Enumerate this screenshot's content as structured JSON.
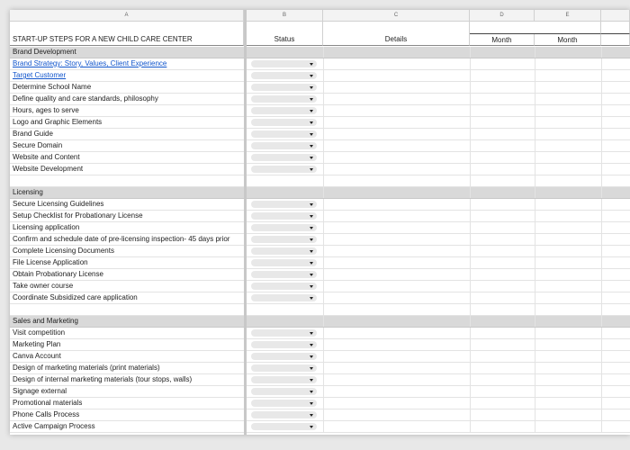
{
  "columns": [
    "A",
    "B",
    "C",
    "D",
    "E"
  ],
  "header": {
    "title": "START-UP STEPS FOR A NEW CHILD CARE CENTER",
    "status": "Status",
    "details": "Details",
    "month_d": "Month",
    "month_e": "Month"
  },
  "rows": [
    {
      "type": "section",
      "text": "Brand Development"
    },
    {
      "type": "item",
      "text": "Brand Strategy: Story, Values, Client Experience",
      "link": true
    },
    {
      "type": "item",
      "text": "Target Customer",
      "link": true
    },
    {
      "type": "item",
      "text": "Determine School Name"
    },
    {
      "type": "item",
      "text": "Define quality and care standards, philosophy"
    },
    {
      "type": "item",
      "text": "Hours, ages to serve"
    },
    {
      "type": "item",
      "text": "Logo and Graphic Elements"
    },
    {
      "type": "item",
      "text": "Brand Guide"
    },
    {
      "type": "item",
      "text": "Secure Domain"
    },
    {
      "type": "item",
      "text": "Website and Content"
    },
    {
      "type": "item",
      "text": "Website Development"
    },
    {
      "type": "blank",
      "text": ""
    },
    {
      "type": "section",
      "text": "Licensing"
    },
    {
      "type": "item",
      "text": "Secure Licensing Guidelines"
    },
    {
      "type": "item",
      "text": "Setup Checklist for Probationary License"
    },
    {
      "type": "item",
      "text": "Licensing application"
    },
    {
      "type": "item",
      "text": "Confirm and schedule date of pre-licensing inspection- 45 days prior"
    },
    {
      "type": "item",
      "text": "Complete Licensing Documents"
    },
    {
      "type": "item",
      "text": "File License Application"
    },
    {
      "type": "item",
      "text": "Obtain Probationary License"
    },
    {
      "type": "item",
      "text": "Take owner course"
    },
    {
      "type": "item",
      "text": "Coordinate Subsidized care application"
    },
    {
      "type": "blank",
      "text": ""
    },
    {
      "type": "section",
      "text": "Sales and Marketing"
    },
    {
      "type": "item",
      "text": "Visit competition"
    },
    {
      "type": "item",
      "text": "Marketing Plan"
    },
    {
      "type": "item",
      "text": "Canva Account"
    },
    {
      "type": "item",
      "text": "Design of marketing materials (print materials)"
    },
    {
      "type": "item",
      "text": "Design of internal marketing materials (tour stops, walls)"
    },
    {
      "type": "item",
      "text": "Signage external"
    },
    {
      "type": "item",
      "text": "Promotional materials"
    },
    {
      "type": "item",
      "text": "Phone Calls Process"
    },
    {
      "type": "item",
      "text": "Active Campaign Process"
    }
  ],
  "colors": {
    "section_bg": "#d9d9d9",
    "link": "#1155cc",
    "dropdown_bg": "#e8e8e8"
  }
}
